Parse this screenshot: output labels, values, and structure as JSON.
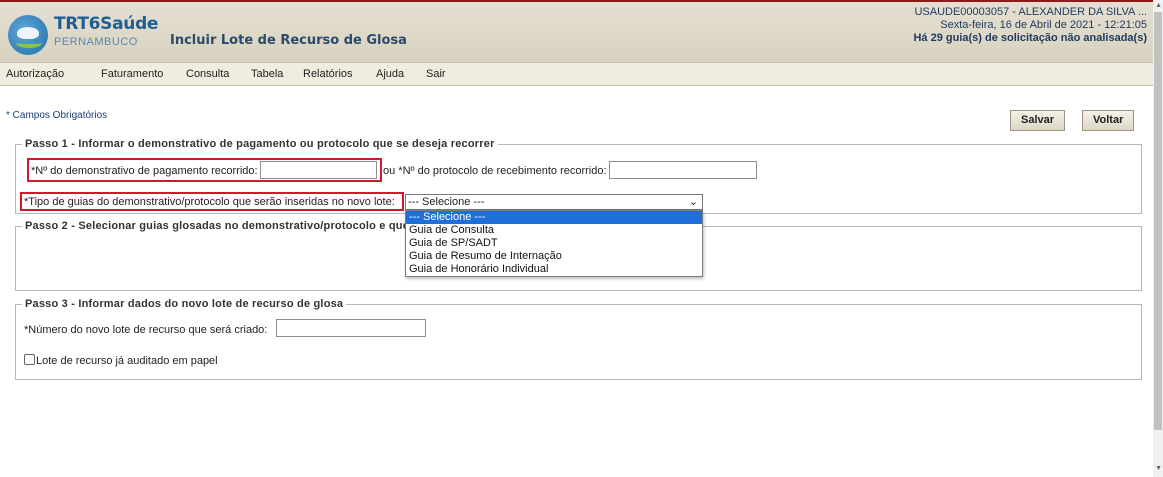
{
  "logo": {
    "title": "TRT6Saúde",
    "subtitle": "PERNAMBUCO"
  },
  "header": {
    "page_title": "Incluir Lote de Recurso de Glosa",
    "user": "USAUDE00003057 - ALEXANDER DA SILVA ...",
    "date": "Sexta-feira, 16 de Abril de 2021 - 12:21:05",
    "warning": "Há 29 guia(s) de solicitação não analisada(s)"
  },
  "menu": [
    "Autorização",
    "Faturamento",
    "Consulta",
    "Tabela",
    "Relatórios",
    "Ajuda",
    "Sair"
  ],
  "required_note": "* Campos Obrigatórios",
  "buttons": {
    "save": "Salvar",
    "back": "Voltar"
  },
  "step1": {
    "legend": "Passo 1 - Informar o demonstrativo de pagamento ou protocolo que se deseja recorrer",
    "demonstrativo_label": "*Nº do demonstrativo de pagamento recorrido:",
    "demonstrativo_value": "",
    "protocolo_label": "ou *Nº do protocolo de recebimento recorrido:",
    "protocolo_value": "",
    "tipo_label": "*Tipo de guias do demonstrativo/protocolo que serão inseridas no novo lote:",
    "tipo_selected": "--- Selecione ---",
    "tipo_options": [
      "--- Selecione ---",
      "Guia de Consulta",
      "Guia de SP/SADT",
      "Guia de Resumo de Internação",
      "Guia de Honorário Individual"
    ]
  },
  "step2": {
    "legend": "Passo 2 - Selecionar guias glosadas no demonstrativo/protocolo e que"
  },
  "step3": {
    "legend": "Passo 3 - Informar dados do novo lote de recurso de glosa",
    "lote_label": "*Número do novo lote de recurso que será criado:",
    "lote_value": "",
    "auditado_label": "Lote de recurso já auditado em papel",
    "auditado_checked": false
  },
  "colors": {
    "highlight": "#d0192b",
    "selected_option": "#1e6fd9",
    "brand": "#1f5f95"
  }
}
